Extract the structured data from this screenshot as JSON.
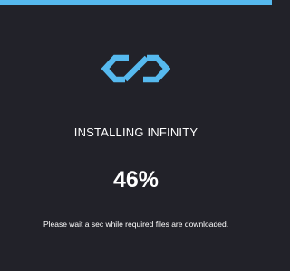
{
  "app": {
    "title": "INSTALLING INFINITY",
    "percent_label": "46%",
    "progress": 1.0,
    "message": "Please wait a sec while required files are downloaded."
  },
  "logo": {
    "icon": "infinity-logo-icon",
    "color": "#56b9ee"
  },
  "colors": {
    "background": "#222229",
    "accent": "#56b9ee",
    "text": "#ffffff"
  }
}
